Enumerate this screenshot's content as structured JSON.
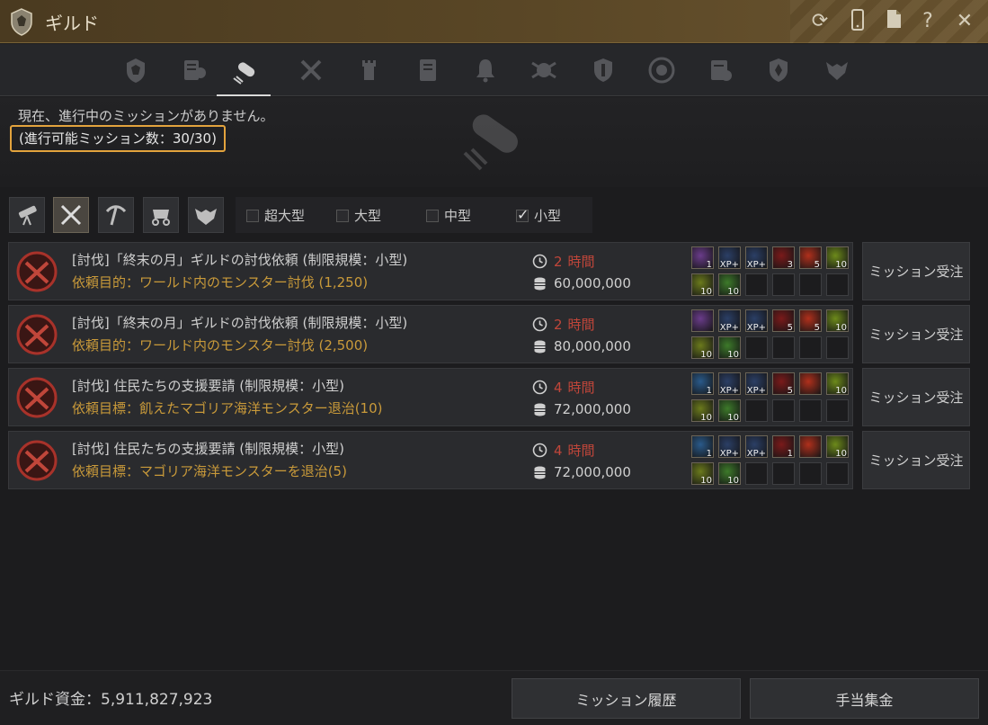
{
  "window": {
    "title": "ギルド"
  },
  "info": {
    "message": "現在、進行中のミッションがありません。",
    "available_count": "(進行可能ミッション数：30/30)"
  },
  "tabs": [
    {
      "icon": "guild-crest-icon"
    },
    {
      "icon": "member-list-icon"
    },
    {
      "icon": "scroll-icon",
      "active": true
    },
    {
      "icon": "crossed-weapons-icon"
    },
    {
      "icon": "tower-icon"
    },
    {
      "icon": "notice-board-icon"
    },
    {
      "icon": "bell-icon"
    },
    {
      "icon": "war-icon"
    },
    {
      "icon": "shield-icon"
    },
    {
      "icon": "emblem-icon"
    },
    {
      "icon": "record-icon"
    },
    {
      "icon": "alliance-icon"
    },
    {
      "icon": "beast-icon"
    }
  ],
  "filters": {
    "type_buttons": [
      {
        "icon": "telescope-icon"
      },
      {
        "icon": "crossed-swords-icon",
        "active": true
      },
      {
        "icon": "pickaxe-icon"
      },
      {
        "icon": "carriage-icon"
      },
      {
        "icon": "monster-icon"
      }
    ],
    "sizes": [
      {
        "label": "超大型",
        "checked": false
      },
      {
        "label": "大型",
        "checked": false
      },
      {
        "label": "中型",
        "checked": false
      },
      {
        "label": "小型",
        "checked": true
      }
    ]
  },
  "missions": [
    {
      "title": "[討伐]「終末の月」ギルドの討伐依頼 (制限規模：小型)",
      "goal": "依頼目的：ワールド内のモンスター討伐 (1,250)",
      "time_num": "2",
      "time_unit": "時間",
      "funds": "60,000,000",
      "accept": "ミッション受注",
      "rewards": [
        {
          "color": "#6a3c8a",
          "badge": "1"
        },
        {
          "color": "#2b3f66",
          "badge": "EXP+"
        },
        {
          "color": "#2b3f66",
          "badge": "EXP+"
        },
        {
          "color": "#7a1a1a",
          "badge": "3"
        },
        {
          "color": "#b0301c",
          "badge": "5"
        },
        {
          "color": "#6d8a1a",
          "badge": "10"
        },
        {
          "color": "#6b7a1c",
          "badge": "10"
        },
        {
          "color": "#3d7a2a",
          "badge": "10"
        }
      ]
    },
    {
      "title": "[討伐]「終末の月」ギルドの討伐依頼 (制限規模：小型)",
      "goal": "依頼目的：ワールド内のモンスター討伐 (2,500)",
      "time_num": "2",
      "time_unit": "時間",
      "funds": "80,000,000",
      "accept": "ミッション受注",
      "rewards": [
        {
          "color": "#6a3c8a",
          "badge": ""
        },
        {
          "color": "#2b3f66",
          "badge": "EXP+"
        },
        {
          "color": "#2b3f66",
          "badge": "EXP+"
        },
        {
          "color": "#7a1a1a",
          "badge": "5"
        },
        {
          "color": "#b0301c",
          "badge": "5"
        },
        {
          "color": "#6d8a1a",
          "badge": "10"
        },
        {
          "color": "#6b7a1c",
          "badge": "10"
        },
        {
          "color": "#3d7a2a",
          "badge": "10"
        }
      ]
    },
    {
      "title": "[討伐] 住民たちの支援要請 (制限規模：小型)",
      "goal": "依頼目標：飢えたマゴリア海洋モンスター退治(10)",
      "time_num": "4",
      "time_unit": "時間",
      "funds": "72,000,000",
      "accept": "ミッション受注",
      "rewards": [
        {
          "color": "#2a5a8a",
          "badge": "1"
        },
        {
          "color": "#2b3f66",
          "badge": "EXP+"
        },
        {
          "color": "#2b3f66",
          "badge": "EXP+"
        },
        {
          "color": "#7a1a1a",
          "badge": "5"
        },
        {
          "color": "#b0301c",
          "badge": ""
        },
        {
          "color": "#6d8a1a",
          "badge": "10"
        },
        {
          "color": "#6b7a1c",
          "badge": "10"
        },
        {
          "color": "#3d7a2a",
          "badge": "10"
        }
      ]
    },
    {
      "title": "[討伐] 住民たちの支援要請 (制限規模：小型)",
      "goal": "依頼目標：マゴリア海洋モンスターを退治(5)",
      "time_num": "4",
      "time_unit": "時間",
      "funds": "72,000,000",
      "accept": "ミッション受注",
      "rewards": [
        {
          "color": "#2a5a8a",
          "badge": "1"
        },
        {
          "color": "#2b3f66",
          "badge": "EXP+"
        },
        {
          "color": "#2b3f66",
          "badge": "EXP+"
        },
        {
          "color": "#7a1a1a",
          "badge": "1"
        },
        {
          "color": "#b0301c",
          "badge": ""
        },
        {
          "color": "#6d8a1a",
          "badge": "10"
        },
        {
          "color": "#6b7a1c",
          "badge": "10"
        },
        {
          "color": "#3d7a2a",
          "badge": "10"
        }
      ]
    }
  ],
  "footer": {
    "funds": "ギルド資金：5,911,827,923",
    "history_button": "ミッション履歴",
    "allowance_button": "手当集金"
  },
  "colors": {
    "accent": "#e3a33d",
    "time": "#c0463a",
    "goal": "#c99a3a"
  }
}
